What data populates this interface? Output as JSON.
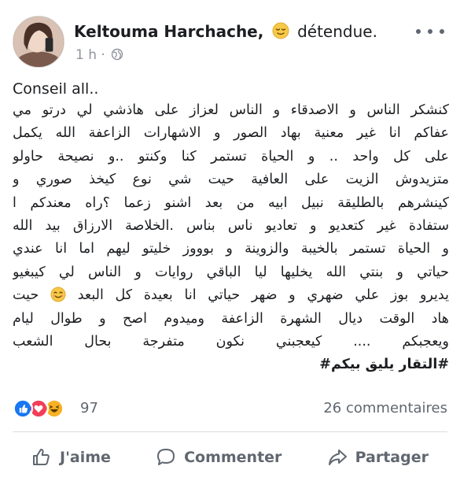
{
  "post": {
    "author": "Keltouma Harchache,",
    "feeling": "détendue.",
    "timestamp": "1 h ·",
    "privacy_icon": "globe-icon",
    "more_icon": "more-options-icon",
    "intro": "Conseil all..",
    "lines": [
      "كنشكر الناس و الاصدقاء و الناس لعزاز على هاذشي لي درتو مي",
      "عفاكم انا غير معنية بهاد الصور و الاشهارات الزاعفة  الله يكمل",
      "على كل واحد .. و الحياة تستمر كنا وكنتو ..و نصيحة حاولو",
      "متزيدوش الزيت على العافية حيت شي نوع كيخذ صوري و",
      "كينشرهم بالطليقة  نبيل ابيه من بعد اشنو زعما  ؟راه معندكم ا",
      "ستفادة  غير كتعديو و تعاديو ناس بناس .الخلاصة الارزاق بيد الله",
      "و الحياة تستمر بالخيبة والزوينة و بوووز خليتو ليهم اما انا عندي",
      "حياتي و بنتي الله يخليها ليا الباقي روايات و الناس لي كيبغيو"
    ],
    "line_emoji_before": "يديرو بوز علي  ضهري و ضهر حياتي  انا بعيدة كل البعد",
    "line_emoji_after": "حيت",
    "lines_after": [
      "هاد الوقت ديال  الشهرة الزاعفة وميدوم اصح و طوال ليام",
      "ويعجبكم .... كيعجبني نكون متفرجة بحال الشعب"
    ],
    "hashtag": "#التقار يليق بيكم#"
  },
  "reactions": {
    "icons": [
      "like-reaction-icon",
      "love-reaction-icon",
      "haha-reaction-icon"
    ],
    "count": "97",
    "comments": "26 commentaires"
  },
  "actions": {
    "like": "J'aime",
    "comment": "Commenter",
    "share": "Partager"
  },
  "colors": {
    "like_blue": "#1877f2",
    "love_red": "#f33e58",
    "haha_yellow": "#f7b125",
    "secondary_text": "#606770"
  }
}
